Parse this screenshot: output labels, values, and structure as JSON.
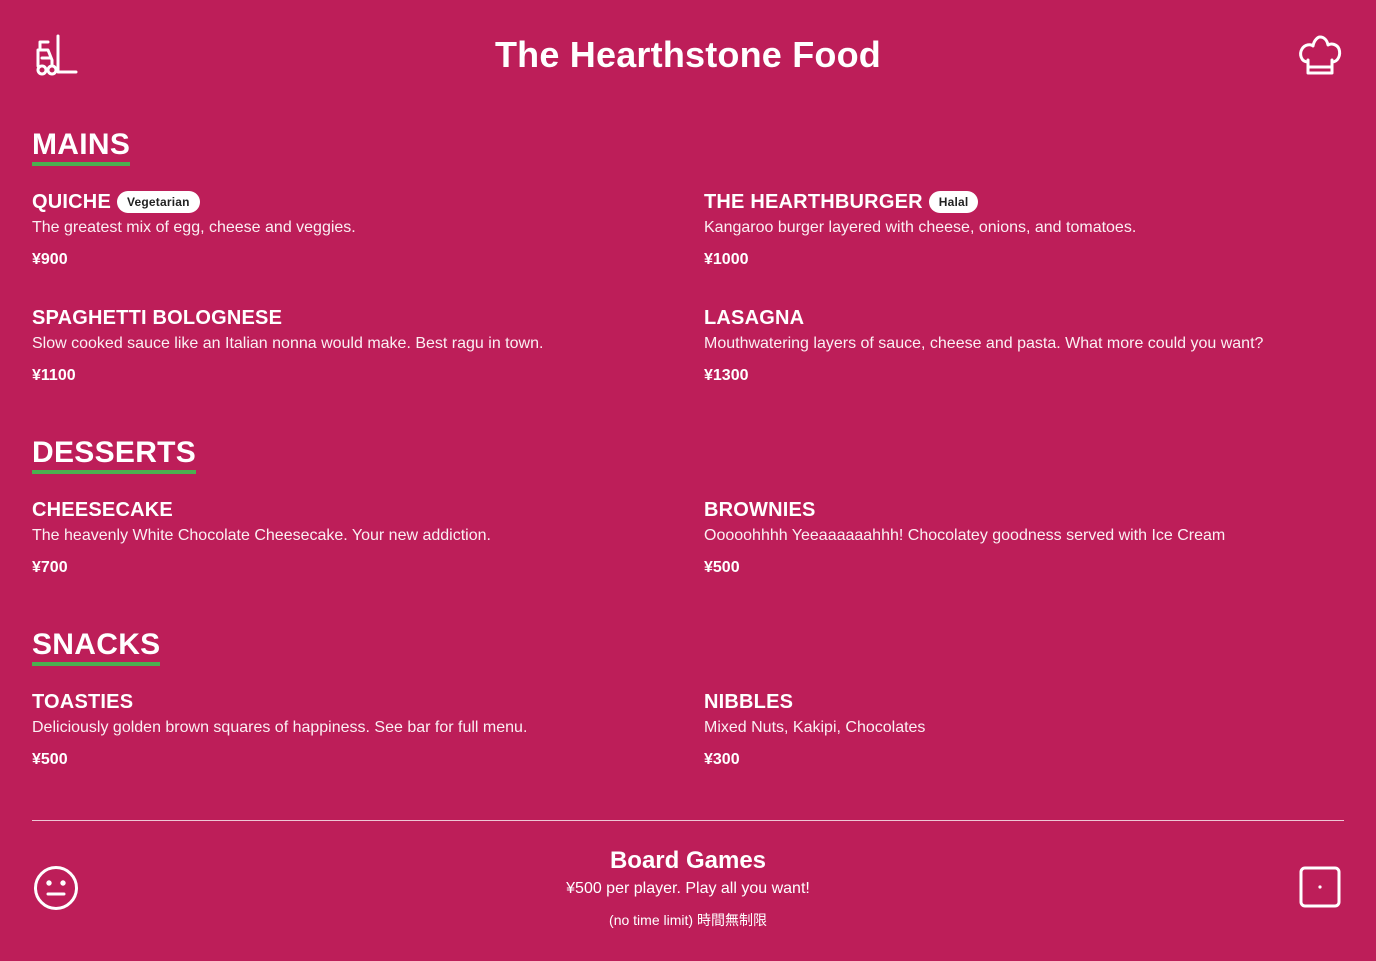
{
  "header": {
    "title": "The Hearthstone Food",
    "left_icon": "forklift-icon",
    "right_icon": "chef-hat-icon"
  },
  "sections": [
    {
      "title": "MAINS",
      "items": [
        {
          "name": "QUICHE",
          "badge": "Vegetarian",
          "description": "The greatest mix of egg, cheese and veggies.",
          "price": "¥900"
        },
        {
          "name": "THE HEARTHBURGER",
          "badge": "Halal",
          "description": "Kangaroo burger layered with cheese, onions, and tomatoes.",
          "price": "¥1000"
        },
        {
          "name": "SPAGHETTI BOLOGNESE",
          "description": "Slow cooked sauce like an Italian nonna would make. Best ragu in town.",
          "price": "¥1100"
        },
        {
          "name": "LASAGNA",
          "description": "Mouthwatering layers of sauce, cheese and pasta. What more could you want?",
          "price": "¥1300"
        }
      ]
    },
    {
      "title": "DESSERTS",
      "items": [
        {
          "name": "CHEESECAKE",
          "description": "The heavenly White Chocolate Cheesecake. Your new addiction.",
          "price": "¥700"
        },
        {
          "name": "BROWNIES",
          "description": "Ooooohhhh Yeeaaaaaahhh! Chocolatey goodness served with Ice Cream",
          "price": "¥500"
        }
      ]
    },
    {
      "title": "SNACKS",
      "items": [
        {
          "name": "TOASTIES",
          "description": "Deliciously golden brown squares of happiness. See bar for full menu.",
          "price": "¥500"
        },
        {
          "name": "NIBBLES",
          "description": "Mixed Nuts, Kakipi, Chocolates",
          "price": "¥300"
        }
      ]
    }
  ],
  "footer": {
    "title": "Board Games",
    "subtitle": "¥500 per player. Play all you want!",
    "note": "(no time limit) 時間無制限",
    "left_icon": "smiley-icon",
    "right_icon": "die-icon"
  },
  "colors": {
    "background": "#bd1e59",
    "text": "#ffffff",
    "section_underline": "#4caf50",
    "badge_background": "#ffffff"
  }
}
